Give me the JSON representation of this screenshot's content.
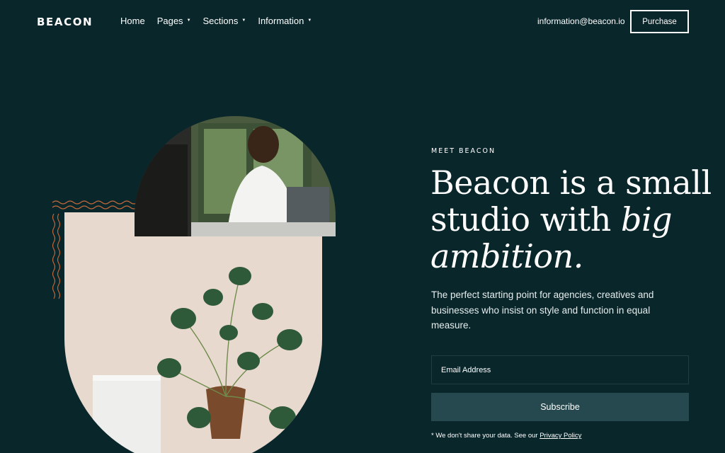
{
  "nav": {
    "logo": "BEACON",
    "items": [
      {
        "label": "Home",
        "has_dropdown": false
      },
      {
        "label": "Pages",
        "has_dropdown": true
      },
      {
        "label": "Sections",
        "has_dropdown": true
      },
      {
        "label": "Information",
        "has_dropdown": true
      }
    ],
    "email": "information@beacon.io",
    "purchase_label": "Purchase"
  },
  "hero": {
    "eyebrow": "MEET BEACON",
    "headline_part1": "Beacon is a small studio with ",
    "headline_italic": "big ambition.",
    "intro": "The perfect starting point for agencies, creatives and businesses who insist on style and function in equal measure.",
    "email_placeholder": "Email Address",
    "subscribe_label": "Subscribe",
    "privacy_prefix": "* We don't share your data. See our ",
    "privacy_link": "Privacy Policy"
  },
  "colors": {
    "background": "#09262b",
    "button": "#26494f",
    "accent_squiggle": "#c0673a",
    "arch": "#e8d9cf"
  }
}
